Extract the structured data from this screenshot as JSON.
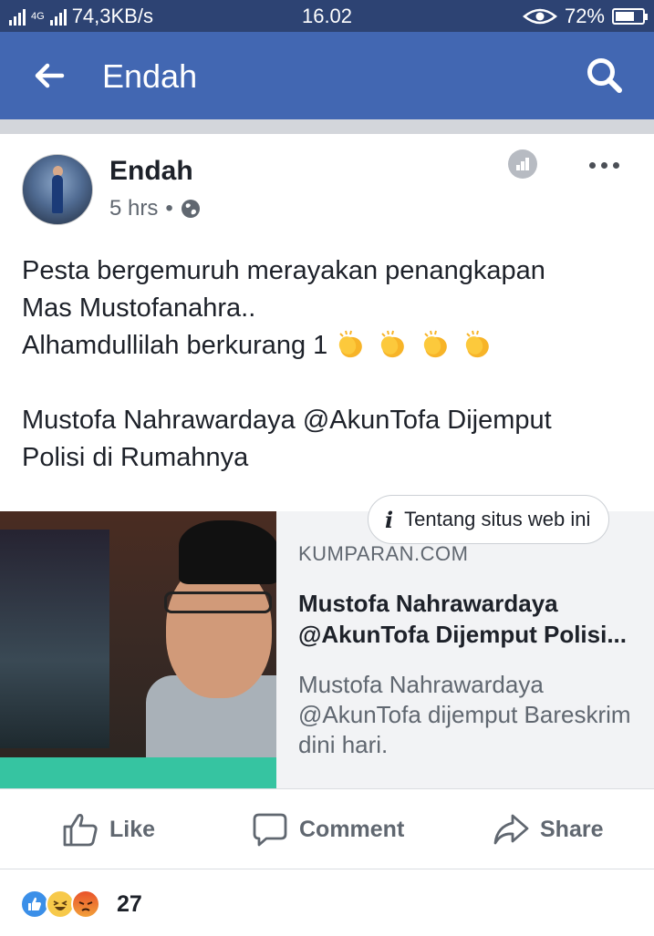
{
  "status_bar": {
    "network_speed": "74,3KB/s",
    "network_type": "4G",
    "time": "16.02",
    "battery_percent": "72%",
    "battery_level": 0.72
  },
  "app_bar": {
    "title": "Endah",
    "back_icon": "arrow-left-icon",
    "search_icon": "search-icon"
  },
  "post": {
    "author": "Endah",
    "time": "5 hrs",
    "privacy_icon": "globe-icon",
    "text_lines": [
      "Pesta bergemuruh merayakan penangkapan",
      "Mas Mustofanahra..",
      "Alhamdullilah berkurang 1",
      "",
      "Mustofa Nahrawardaya @AkunTofa Dijemput",
      "Polisi di Rumahnya"
    ],
    "emoji": "clapping-hands x4"
  },
  "link_preview": {
    "about_label": "Tentang situs web ini",
    "domain": "KUMPARAN.COM",
    "title_line1": "Mustofa Nahrawardaya",
    "title_line2": "@AkunTofa Dijemput Polisi...",
    "description": "Mustofa Nahrawardaya @AkunTofa dijemput Bareskrim dini hari."
  },
  "actions": {
    "like": "Like",
    "comment": "Comment",
    "share": "Share"
  },
  "reactions": {
    "count": "27",
    "types": [
      "like",
      "haha",
      "angry"
    ]
  },
  "colors": {
    "brand_blue": "#4267b2",
    "status_bar": "#2d4373"
  }
}
